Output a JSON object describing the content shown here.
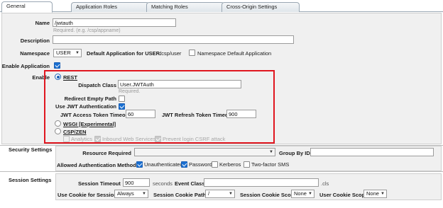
{
  "tabs": [
    {
      "label": "General"
    },
    {
      "label": "Application Roles"
    },
    {
      "label": "Matching Roles"
    },
    {
      "label": "Cross-Origin Settings"
    }
  ],
  "general": {
    "name_label": "Name",
    "name_value": "/jwtauth",
    "name_hint": "Required. (e.g. /csp/appname)",
    "description_label": "Description",
    "description_value": "",
    "namespace_label": "Namespace",
    "namespace_value": "USER",
    "default_app_label": "Default Application for USER:",
    "default_app_value": "/csp/user",
    "ns_default_label": "Namespace Default Application",
    "enable_app_label": "Enable Application",
    "enable_label": "Enable"
  },
  "rest": {
    "label": "REST",
    "dispatch_label": "Dispatch Class",
    "dispatch_value": "User.JWTAuth",
    "dispatch_hint": "Required.",
    "redirect_label": "Redirect Empty Path",
    "use_jwt_label": "Use JWT Authentication",
    "access_timeout_label": "JWT Access Token Timeout",
    "access_timeout_value": "60",
    "refresh_timeout_label": "JWT Refresh Token Timeout",
    "refresh_timeout_value": "900"
  },
  "wsgi": {
    "label": "WSGI [Experimental]"
  },
  "cspzen": {
    "label": "CSP/ZEN",
    "analytics_label": "Analytics",
    "inbound_label": "Inbound Web Services",
    "csrf_label": "Prevent login CSRF attack"
  },
  "security": {
    "section_label": "Security Settings",
    "resource_label": "Resource Required",
    "resource_value": "",
    "group_label": "Group By ID",
    "group_value": "",
    "auth_label": "Allowed Authentication Methods",
    "methods": [
      {
        "label": "Unauthenticated",
        "checked": true
      },
      {
        "label": "Password",
        "checked": true
      },
      {
        "label": "Kerberos",
        "checked": false
      },
      {
        "label": "Two-factor SMS",
        "checked": false
      }
    ]
  },
  "session": {
    "section_label": "Session Settings",
    "timeout_label": "Session Timeout",
    "timeout_value": "900",
    "timeout_unit": "seconds",
    "event_label": "Event Class",
    "event_value": "",
    "event_suffix": ".cls",
    "cookie_label": "Use Cookie for Session",
    "cookie_value": "Always",
    "cookie_path_label": "Session Cookie Path",
    "cookie_path_value": "/",
    "cookie_scope_label": "Session Cookie Scope",
    "cookie_scope_value": "None",
    "user_cookie_label": "User Cookie Scope",
    "user_cookie_value": "None"
  },
  "colors": {
    "highlight_border": "#e0161f",
    "checkbox_accent": "#1a6fd1"
  }
}
